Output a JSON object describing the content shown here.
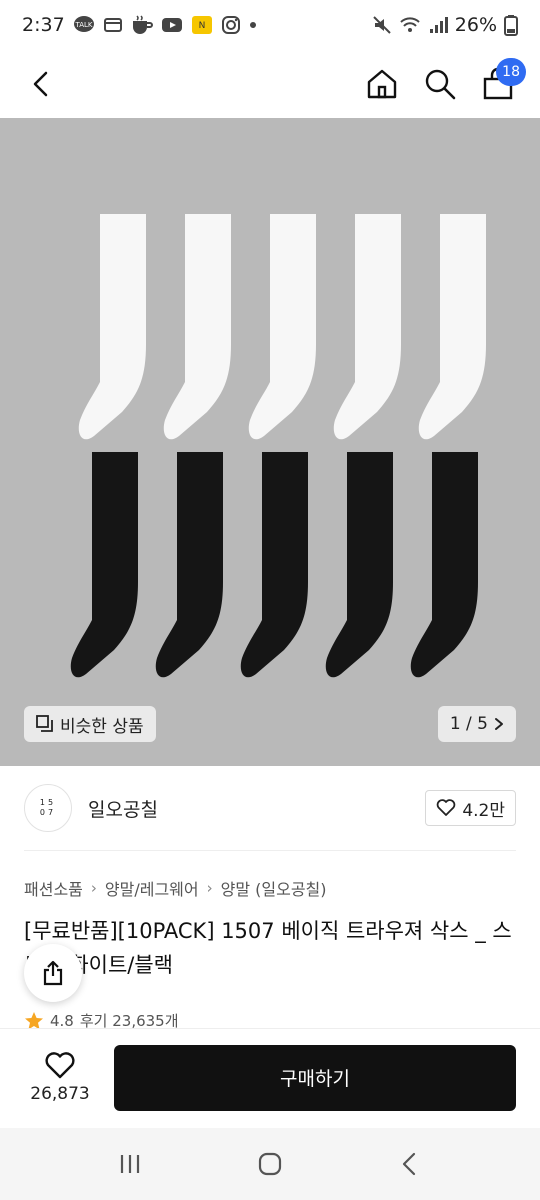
{
  "status": {
    "time": "2:37",
    "notification_icons": [
      "talk-icon",
      "wallet-icon",
      "coffee-icon",
      "youtube-icon",
      "app-icon",
      "instagram-icon",
      "dot-icon"
    ],
    "battery": "26%"
  },
  "header": {
    "cart_count": "18"
  },
  "hero": {
    "similar_label": "비슷한 상품",
    "pager": "1 / 5",
    "sock_colors": {
      "white": "#f7f7f7",
      "black": "#151515",
      "background": "#b9b9b9"
    }
  },
  "brand": {
    "logo_top": "15",
    "logo_bottom": "07",
    "name": "일오공칠",
    "likes": "4.2만"
  },
  "breadcrumb": [
    "패션소품",
    "양말/레그웨어",
    "양말 (일오공칠)"
  ],
  "product": {
    "title": "[무료반품][10PACK] 1507 베이직 트라우져 삭스 _ 스노우 화이트/블랙",
    "rating": "4.8",
    "reviews": "후기 23,635개"
  },
  "purchase": {
    "wish_count": "26,873",
    "buy_label": "구매하기"
  },
  "colors": {
    "badge": "#2f6bf2",
    "buy_button": "#111111"
  }
}
